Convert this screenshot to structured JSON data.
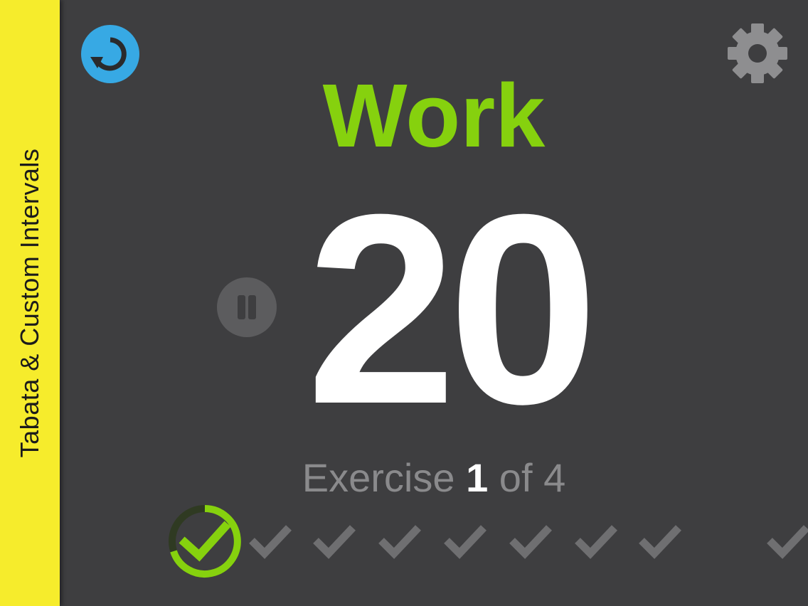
{
  "app": {
    "sidebar_title": "Tabata & Custom Intervals"
  },
  "toolbar": {
    "reset_icon": "reset-icon",
    "settings_icon": "gear-icon"
  },
  "timer": {
    "phase": "Work",
    "seconds": "20",
    "phase_color": "#86d10e"
  },
  "exercise": {
    "prefix": "Exercise",
    "current": "1",
    "of_text": "of",
    "total": "4"
  },
  "colors": {
    "sidebar": "#f6ec2c",
    "background": "#3e3e40",
    "accent_green": "#86d10e",
    "reset_blue": "#37a9e4",
    "inactive_check": "#6f6f71"
  },
  "rounds": [
    {
      "state": "current"
    },
    {
      "state": "pending"
    },
    {
      "state": "pending"
    },
    {
      "state": "pending"
    },
    {
      "state": "pending"
    },
    {
      "state": "pending"
    },
    {
      "state": "pending"
    },
    {
      "state": "pending"
    },
    {
      "state": "pending"
    }
  ]
}
